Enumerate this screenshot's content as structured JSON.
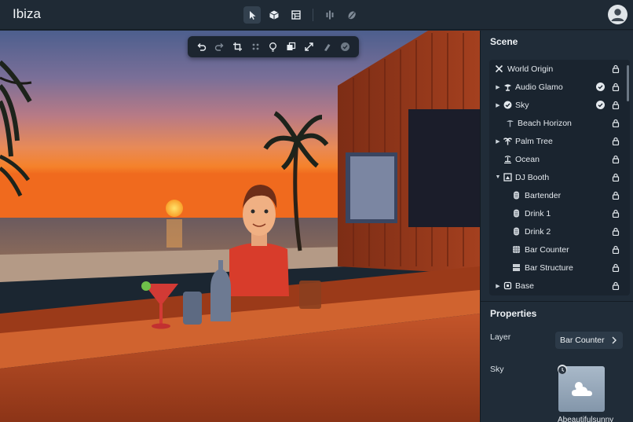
{
  "app": {
    "title": "Ibiza"
  },
  "top_toolbar": {
    "tools": [
      "select-tool",
      "cube-tool",
      "layout-tool",
      "align-tool",
      "physics-tool"
    ]
  },
  "viewport_toolbar": {
    "tools": [
      "undo",
      "redo",
      "crop",
      "grid",
      "lightbulb",
      "copy",
      "expand",
      "brush",
      "confirm"
    ]
  },
  "scene_panel": {
    "title": "Scene",
    "items": [
      {
        "label": "World Origin",
        "depth": 0,
        "caret": "",
        "icon": "world-origin-icon",
        "checked": false
      },
      {
        "label": "Audio Glamo",
        "depth": 0,
        "caret": "right",
        "icon": "audio-icon",
        "checked": true
      },
      {
        "label": "Sky",
        "depth": 0,
        "caret": "right",
        "icon": "sky-check-icon",
        "checked": true
      },
      {
        "label": "Beach Horizon",
        "depth": 1,
        "caret": "",
        "icon": "beach-icon",
        "checked": false
      },
      {
        "label": "Palm Tree",
        "depth": 0,
        "caret": "right",
        "icon": "palm-tree-icon",
        "checked": false
      },
      {
        "label": "Ocean",
        "depth": 0,
        "caret": "",
        "icon": "ocean-icon",
        "checked": false
      },
      {
        "label": "DJ Booth",
        "depth": 0,
        "caret": "down",
        "icon": "dj-booth-icon",
        "checked": false
      },
      {
        "label": "Bartender",
        "depth": 1,
        "caret": "",
        "icon": "character-icon",
        "checked": false
      },
      {
        "label": "Drink 1",
        "depth": 1,
        "caret": "",
        "icon": "character-icon",
        "checked": false
      },
      {
        "label": "Drink 2",
        "depth": 1,
        "caret": "",
        "icon": "character-icon",
        "checked": false
      },
      {
        "label": "Bar Counter",
        "depth": 1,
        "caret": "",
        "icon": "grid-box-icon",
        "checked": false
      },
      {
        "label": "Bar Structure",
        "depth": 1,
        "caret": "",
        "icon": "structure-icon",
        "checked": false
      },
      {
        "label": "Base",
        "depth": 0,
        "caret": "right",
        "icon": "base-icon",
        "checked": false
      }
    ]
  },
  "properties_panel": {
    "title": "Properties",
    "layer_label": "Layer",
    "layer_value": "Bar Counter",
    "sky_label": "Sky",
    "sky_thumbnail_name": "Abeautifulsunny"
  },
  "colors": {
    "panel_bg": "#202c38",
    "topbar_bg": "#1f2a35",
    "sunset_top": "#5a6a96",
    "sunset_horizon": "#f27a2a",
    "wood": "#a8431f"
  }
}
